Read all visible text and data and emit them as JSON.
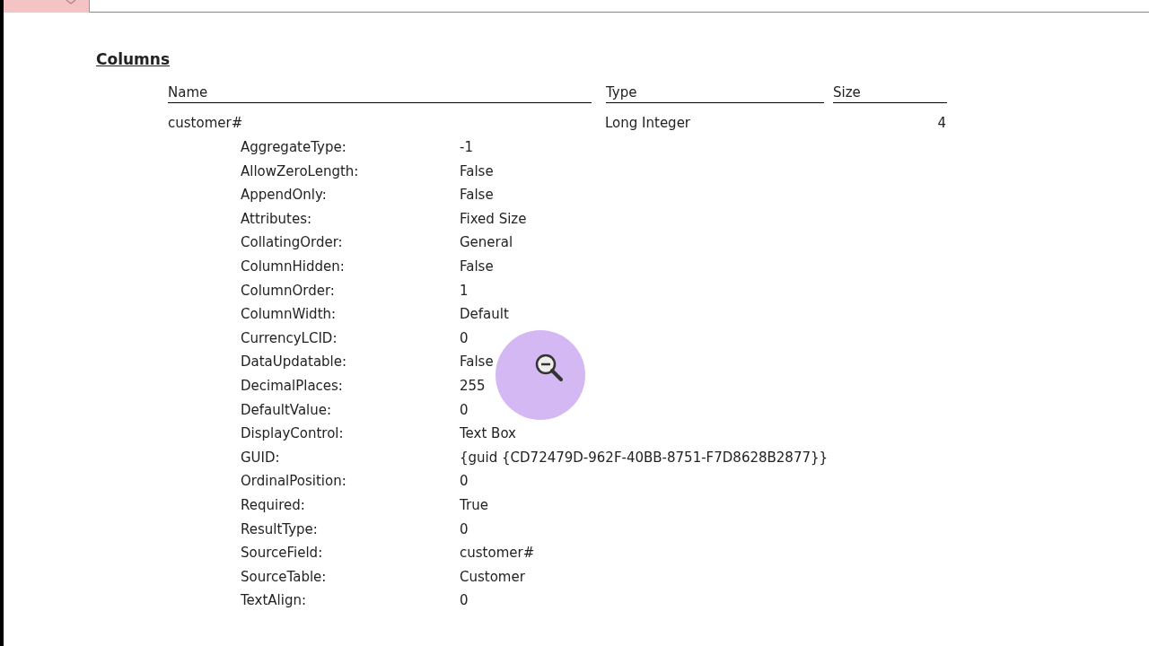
{
  "section_title": "Columns",
  "columns": [
    "Name",
    "Type",
    "Size"
  ],
  "field": {
    "name": "customer#",
    "type": "Long Integer",
    "size": "4"
  },
  "properties": [
    {
      "name": "AggregateType:",
      "value": "-1"
    },
    {
      "name": "AllowZeroLength:",
      "value": "False"
    },
    {
      "name": "AppendOnly:",
      "value": "False"
    },
    {
      "name": "Attributes:",
      "value": "Fixed Size"
    },
    {
      "name": "CollatingOrder:",
      "value": "General"
    },
    {
      "name": "ColumnHidden:",
      "value": "False"
    },
    {
      "name": "ColumnOrder:",
      "value": "1"
    },
    {
      "name": "ColumnWidth:",
      "value": "Default"
    },
    {
      "name": "CurrencyLCID:",
      "value": "0"
    },
    {
      "name": "DataUpdatable:",
      "value": "False"
    },
    {
      "name": "DecimalPlaces:",
      "value": "255"
    },
    {
      "name": "DefaultValue:",
      "value": "0"
    },
    {
      "name": "DisplayControl:",
      "value": "Text Box"
    },
    {
      "name": "GUID:",
      "value": "{guid {CD72479D-962F-40BB-8751-F7D8628B2877}}"
    },
    {
      "name": "OrdinalPosition:",
      "value": "0"
    },
    {
      "name": "Required:",
      "value": "True"
    },
    {
      "name": "ResultType:",
      "value": "0"
    },
    {
      "name": "SourceField:",
      "value": "customer#"
    },
    {
      "name": "SourceTable:",
      "value": "Customer"
    },
    {
      "name": "TextAlign:",
      "value": "0"
    }
  ]
}
